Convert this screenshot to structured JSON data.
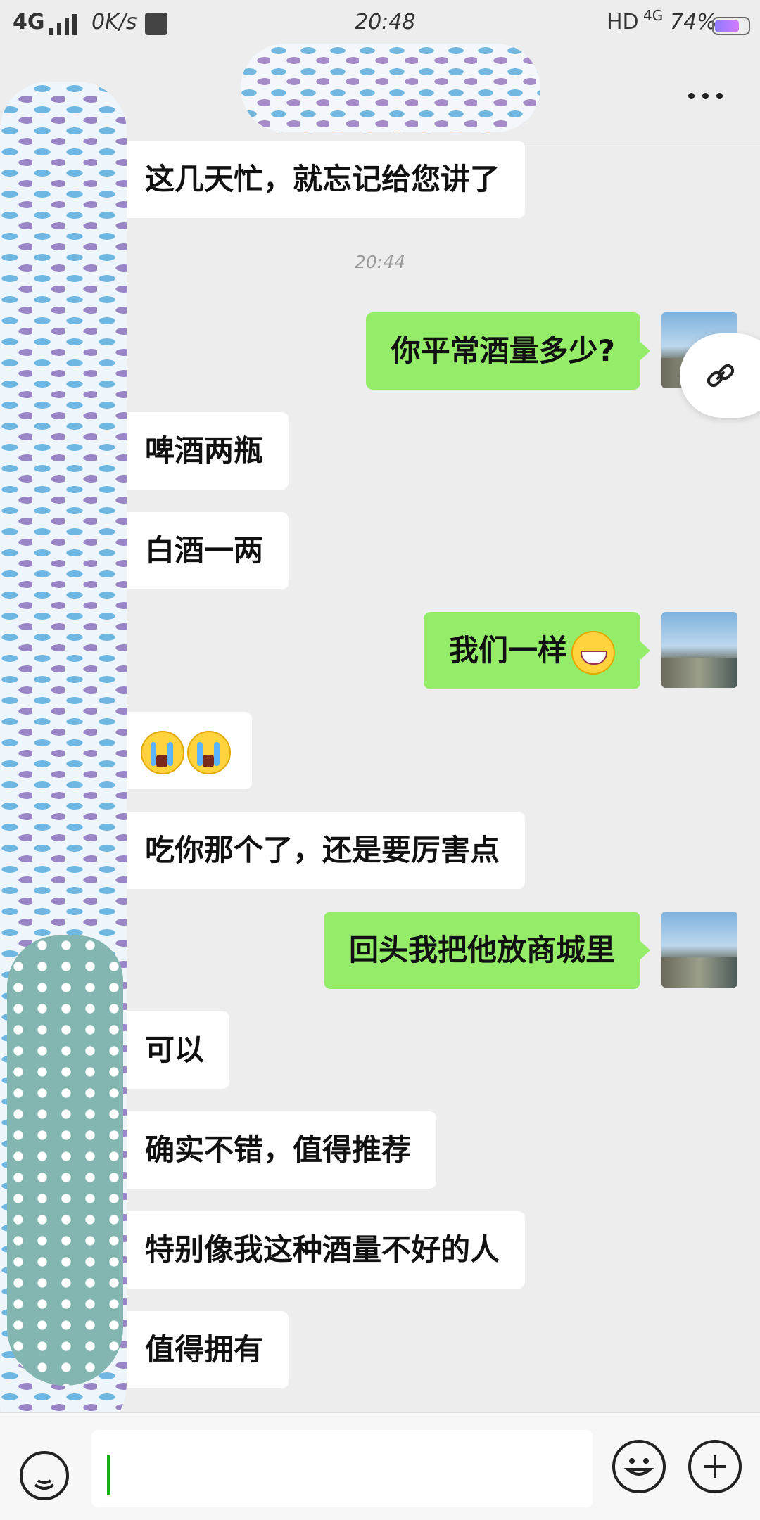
{
  "status_bar": {
    "network": "4G",
    "speed": "0K/s",
    "time": "20:48",
    "hd": "HD",
    "net_small": "4G",
    "battery_text": "74%",
    "battery_level": 0.74
  },
  "chat": {
    "timestamp": "20:44",
    "messages": [
      {
        "side": "in",
        "text": "这几天忙，就忘记给您讲了"
      },
      {
        "side": "out",
        "text": "你平常酒量多少?"
      },
      {
        "side": "in",
        "text": "啤酒两瓶"
      },
      {
        "side": "in",
        "text": "白酒一两"
      },
      {
        "side": "out",
        "text": "我们一样",
        "emoji": "grin-icon"
      },
      {
        "side": "in",
        "text": "",
        "emoji": "crying-icon"
      },
      {
        "side": "in",
        "text": "吃你那个了，还是要厉害点"
      },
      {
        "side": "out",
        "text": "回头我把他放商城里"
      },
      {
        "side": "in",
        "text": "可以"
      },
      {
        "side": "in",
        "text": "确实不错，值得推荐"
      },
      {
        "side": "in",
        "text": "特别像我这种酒量不好的人"
      },
      {
        "side": "in",
        "text": "值得拥有"
      }
    ]
  },
  "colors": {
    "background": "#ededed",
    "incoming_bubble": "#ffffff",
    "outgoing_bubble": "#95ec69",
    "caret": "#1aad19"
  },
  "icons": {
    "menu": "more-icon",
    "link": "link-icon",
    "voice": "voice-icon",
    "emoji": "emoji-icon",
    "add": "plus-icon"
  }
}
